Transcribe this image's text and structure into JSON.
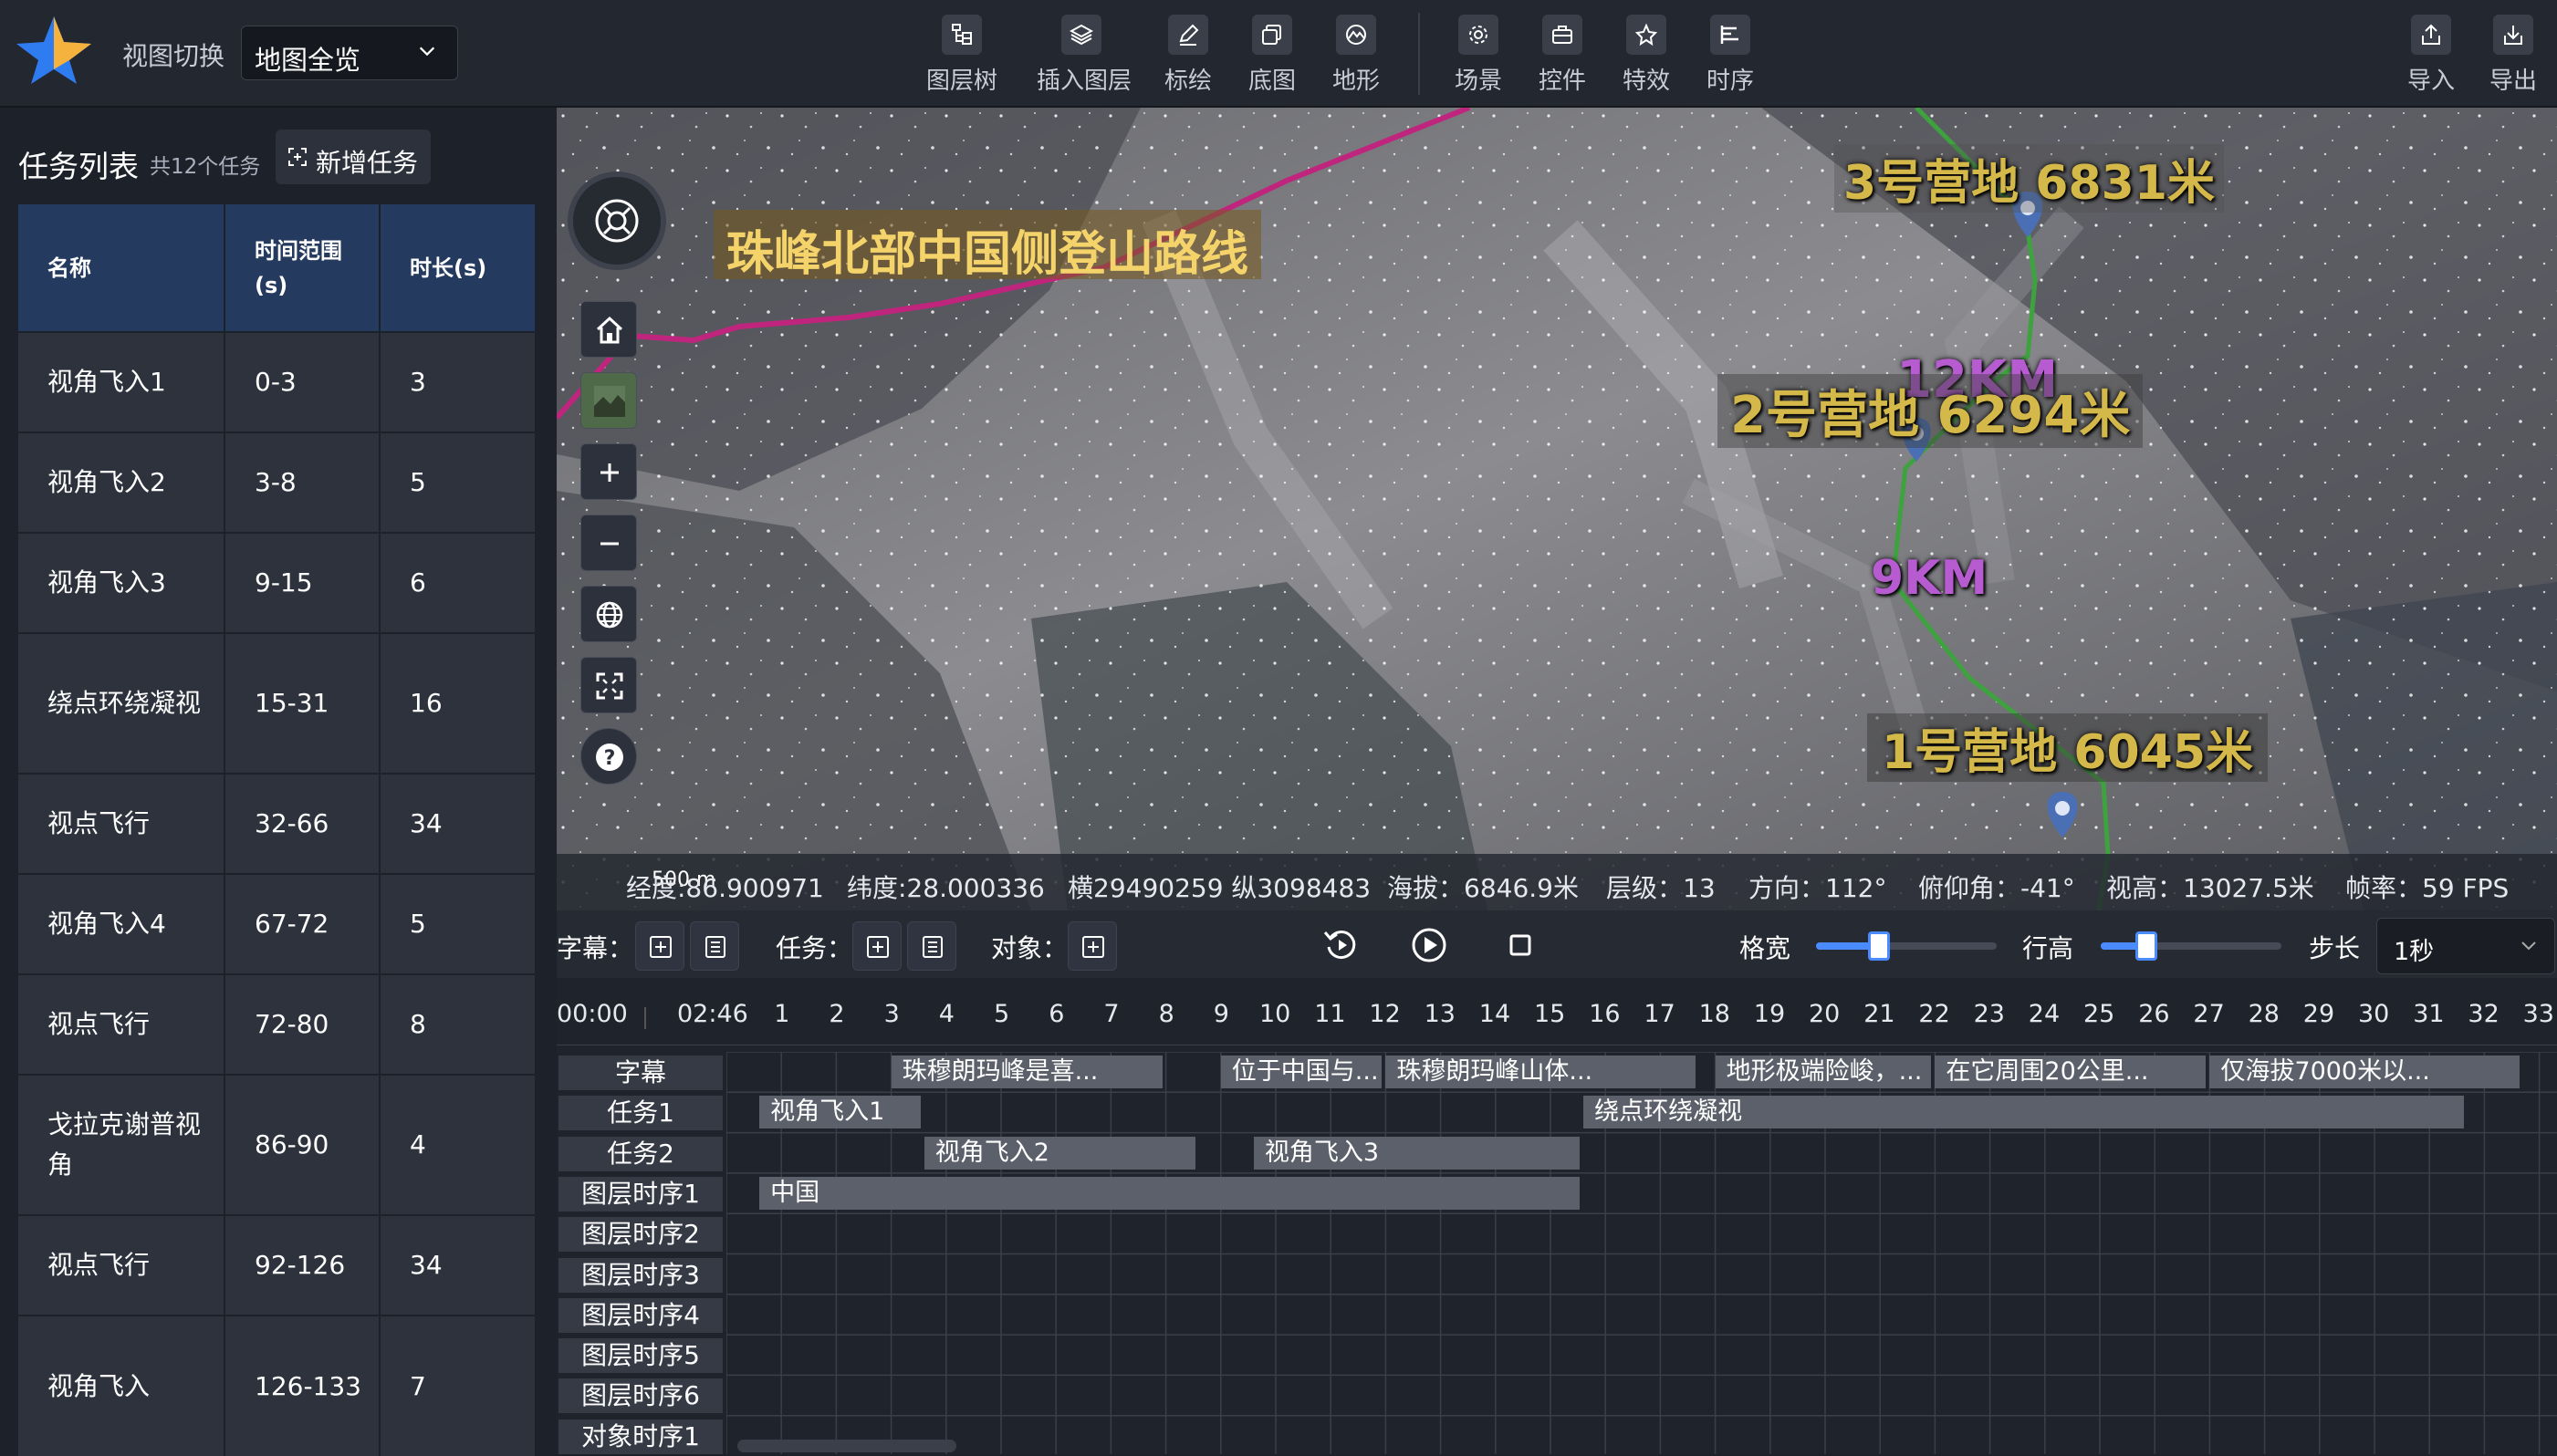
{
  "app": {
    "view_switch_label": "视图切换",
    "view_mode": "地图全览"
  },
  "toolbar": {
    "items": [
      {
        "label": "图层树",
        "icon": "layer-tree-icon"
      },
      {
        "label": "插入图层",
        "icon": "insert-layer-icon"
      },
      {
        "label": "标绘",
        "icon": "draw-icon"
      },
      {
        "label": "底图",
        "icon": "basemap-icon"
      },
      {
        "label": "地形",
        "icon": "terrain-icon"
      },
      {
        "label": "场景",
        "icon": "scene-icon"
      },
      {
        "label": "控件",
        "icon": "control-icon"
      },
      {
        "label": "特效",
        "icon": "effect-icon"
      },
      {
        "label": "时序",
        "icon": "timeline-icon"
      }
    ],
    "import_label": "导入",
    "export_label": "导出"
  },
  "task_panel": {
    "title": "任务列表",
    "count": "共12个任务",
    "add_label": "新增任务",
    "columns": [
      "名称",
      "时间范围(s)",
      "时长(s)"
    ],
    "rows": [
      {
        "name": "视角飞入1",
        "range": "0-3",
        "duration": "3"
      },
      {
        "name": "视角飞入2",
        "range": "3-8",
        "duration": "5"
      },
      {
        "name": "视角飞入3",
        "range": "9-15",
        "duration": "6"
      },
      {
        "name": "绕点环绕凝视",
        "range": "15-31",
        "duration": "16"
      },
      {
        "name": "视点飞行",
        "range": "32-66",
        "duration": "34"
      },
      {
        "name": "视角飞入4",
        "range": "67-72",
        "duration": "5"
      },
      {
        "name": "视点飞行",
        "range": "72-80",
        "duration": "8"
      },
      {
        "name": "戈拉克谢普视角",
        "range": "86-90",
        "duration": "4"
      },
      {
        "name": "视点飞行",
        "range": "92-126",
        "duration": "34"
      },
      {
        "name": "视角飞入",
        "range": "126-133",
        "duration": "7"
      }
    ]
  },
  "map": {
    "route_title": "珠峰北部中国侧登山路线",
    "camps": [
      {
        "label": "3号营地 6831米"
      },
      {
        "label": "2号营地 6294米"
      },
      {
        "label": "1号营地 6045米"
      }
    ],
    "distances": [
      "12KM",
      "9KM"
    ],
    "scale": "500 m",
    "status": {
      "lng": "经度:86.900971",
      "lat": "纬度:28.000336",
      "proj": "横29490259 纵3098483",
      "alt": "海拔：6846.9米",
      "level": "层级：13",
      "heading": "方向：112°",
      "pitch": "俯仰角：-41°",
      "view_height": "视高：13027.5米",
      "fps": "帧率：59 FPS"
    },
    "colors": {
      "route_north": "#c0257e",
      "route_south": "#3ea23f",
      "label": "#d4b94a"
    }
  },
  "timeline": {
    "subtitle_label": "字幕：",
    "task_label": "任务：",
    "object_label": "对象：",
    "width_label": "格宽",
    "row_height_label": "行高",
    "step_label": "步长",
    "step_value": "1秒",
    "width_slider": 0.35,
    "row_height_slider": 0.25,
    "start_time": "00:00",
    "current_time": "02:46",
    "ticks": [
      "1",
      "2",
      "3",
      "4",
      "5",
      "6",
      "7",
      "8",
      "9",
      "10",
      "11",
      "12",
      "13",
      "14",
      "15",
      "16",
      "17",
      "18",
      "19",
      "20",
      "21",
      "22",
      "23",
      "24",
      "25",
      "26",
      "27",
      "28",
      "29",
      "30",
      "31",
      "32",
      "33"
    ],
    "tracks": [
      {
        "label": "字幕",
        "clips": [
          {
            "text": "珠穆朗玛峰是喜...",
            "start": 3,
            "end": 8
          },
          {
            "text": "位于中国与...",
            "start": 9,
            "end": 12
          },
          {
            "text": "珠穆朗玛峰山体...",
            "start": 12,
            "end": 17.7
          },
          {
            "text": "地形极端险峻，...",
            "start": 18,
            "end": 22
          },
          {
            "text": "在它周围20公里...",
            "start": 22,
            "end": 27
          },
          {
            "text": "仅海拔7000米以...",
            "start": 27,
            "end": 32.7
          }
        ]
      },
      {
        "label": "任务1",
        "clips": [
          {
            "text": "视角飞入1",
            "start": 0.6,
            "end": 3.6
          },
          {
            "text": "绕点环绕凝视",
            "start": 15.6,
            "end": 31.7
          }
        ]
      },
      {
        "label": "任务2",
        "clips": [
          {
            "text": "视角飞入2",
            "start": 3.6,
            "end": 8.6
          },
          {
            "text": "视角飞入3",
            "start": 9.6,
            "end": 15.6
          }
        ]
      },
      {
        "label": "图层时序1",
        "clips": [
          {
            "text": "中国",
            "start": 0.6,
            "end": 15.6
          }
        ]
      },
      {
        "label": "图层时序2",
        "clips": []
      },
      {
        "label": "图层时序3",
        "clips": []
      },
      {
        "label": "图层时序4",
        "clips": []
      },
      {
        "label": "图层时序5",
        "clips": []
      },
      {
        "label": "图层时序6",
        "clips": []
      },
      {
        "label": "对象时序1",
        "clips": []
      }
    ]
  }
}
